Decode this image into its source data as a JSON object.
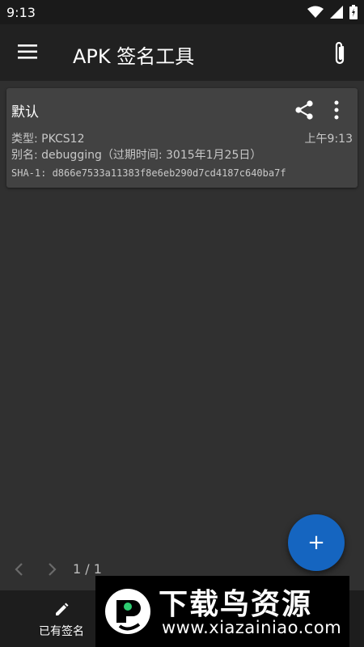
{
  "status_bar": {
    "time": "9:13"
  },
  "app_bar": {
    "title": "APK 签名工具"
  },
  "card": {
    "title": "默认",
    "type_line": "类型: PKCS12",
    "alias_line": "别名: debugging（过期时间: 3015年1月25日）",
    "time": "上午9:13",
    "sha_line": "SHA-1: d866e7533a11383f8e6eb290d7cd4187c640ba7f"
  },
  "pager": {
    "count": "1 / 1"
  },
  "fab": {
    "icon": "add-icon",
    "label": "+"
  },
  "bottom_nav": {
    "tab_label": "已有签名",
    "tab_icon": "pencil-icon"
  },
  "watermark": {
    "title": "下载鸟资源",
    "url": "www.xiazainiao.com"
  },
  "colors": {
    "background": "#303030",
    "card": "#424242",
    "app_bar": "#212121",
    "fab": "#1565c0"
  }
}
